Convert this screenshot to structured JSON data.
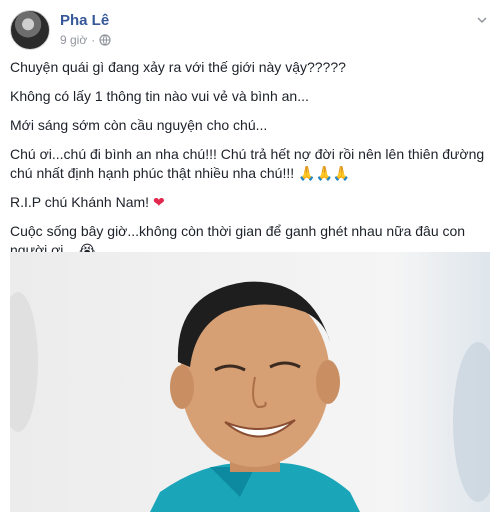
{
  "post": {
    "author": "Pha Lê",
    "time": "9 giờ",
    "separator": "·",
    "icons": {
      "privacy": "globe-icon",
      "menu": "chevron-down-icon"
    },
    "lines": [
      "Chuyện quái gì đang xảy ra với thế giới này vậy?????",
      "Không có lấy 1 thông tin nào vui vẻ và bình an...",
      "Mới sáng sớm còn cầu nguyện cho chú...",
      "Chú ơi...chú đi bình an nha chú!!! Chú trả hết nợ đời rồi nên lên thiên đường chú nhất định hạnh phúc thật nhiều nha chú!!!",
      "R.I.P chú Khánh Nam!",
      "Cuộc sống bây giờ...không còn thời gian để ganh ghét nhau nữa đâu con người ơi..."
    ],
    "emojis": {
      "pray": "🙏🙏🙏",
      "heart": "❤",
      "cry": "😭"
    },
    "colors": {
      "author": "#365899",
      "meta": "#90949c",
      "text": "#1d2129",
      "heart": "#e2264d"
    }
  }
}
